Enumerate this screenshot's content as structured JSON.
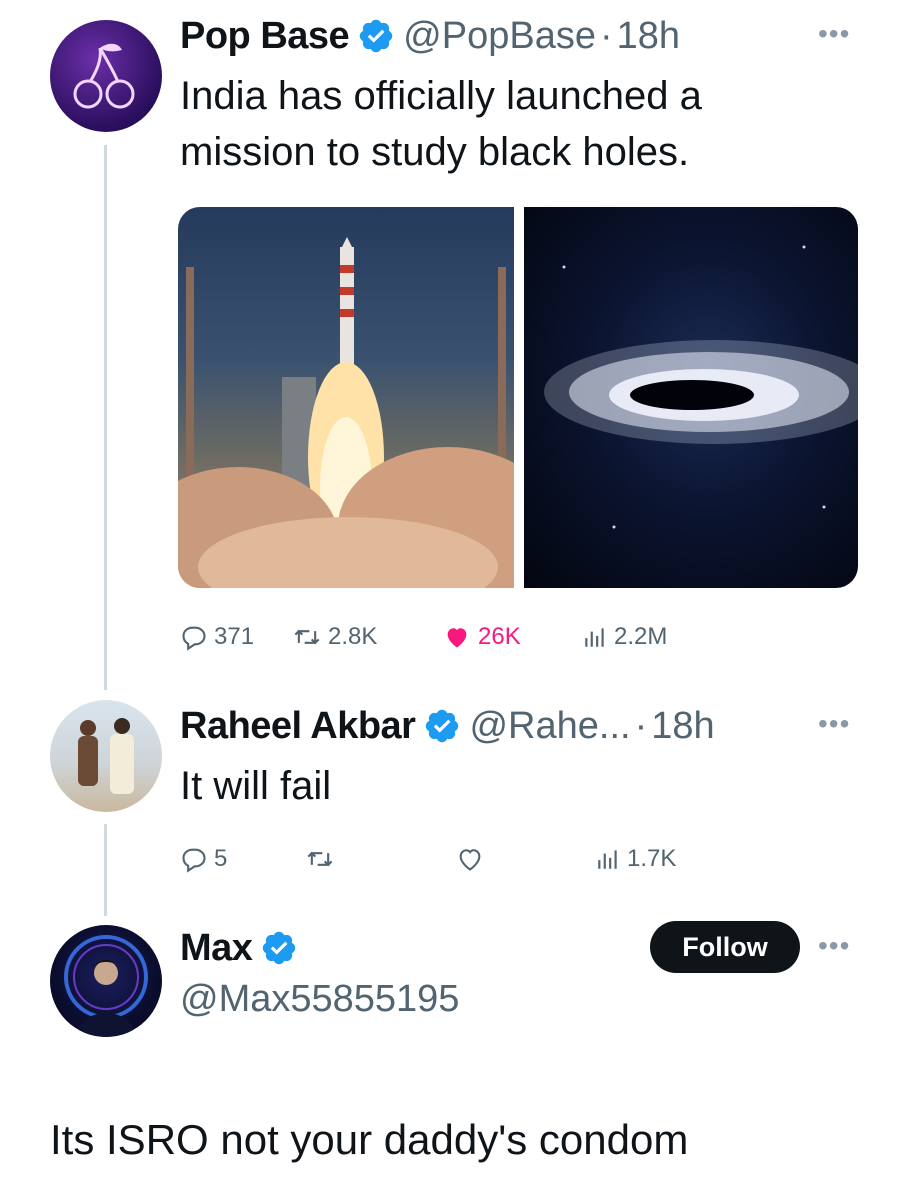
{
  "colors": {
    "verified_blue": "#1d9bf0",
    "like_pink": "#f91880",
    "muted_gray": "#536471",
    "follow_bg": "#0f1419"
  },
  "tweets": [
    {
      "display_name": "Pop Base",
      "handle": "@PopBase",
      "separator": "·",
      "time": "18h",
      "text_line1": "India has officially launched a",
      "text_line2": "mission to study black holes.",
      "replies": "371",
      "retweets": "2.8K",
      "likes": "26K",
      "views": "2.2M"
    },
    {
      "display_name": "Raheel Akbar",
      "handle": "@Rahe...",
      "separator": "·",
      "time": "18h",
      "text": "It will fail",
      "replies": "5",
      "views": "1.7K"
    }
  ],
  "quote_user": {
    "display_name": "Max",
    "handle": "@Max55855195",
    "follow_label": "Follow",
    "text": "Its ISRO not your daddy's condom"
  },
  "icons": [
    "verified-badge-icon",
    "reply-icon",
    "retweet-icon",
    "like-icon",
    "views-icon",
    "more-dots-icon"
  ]
}
